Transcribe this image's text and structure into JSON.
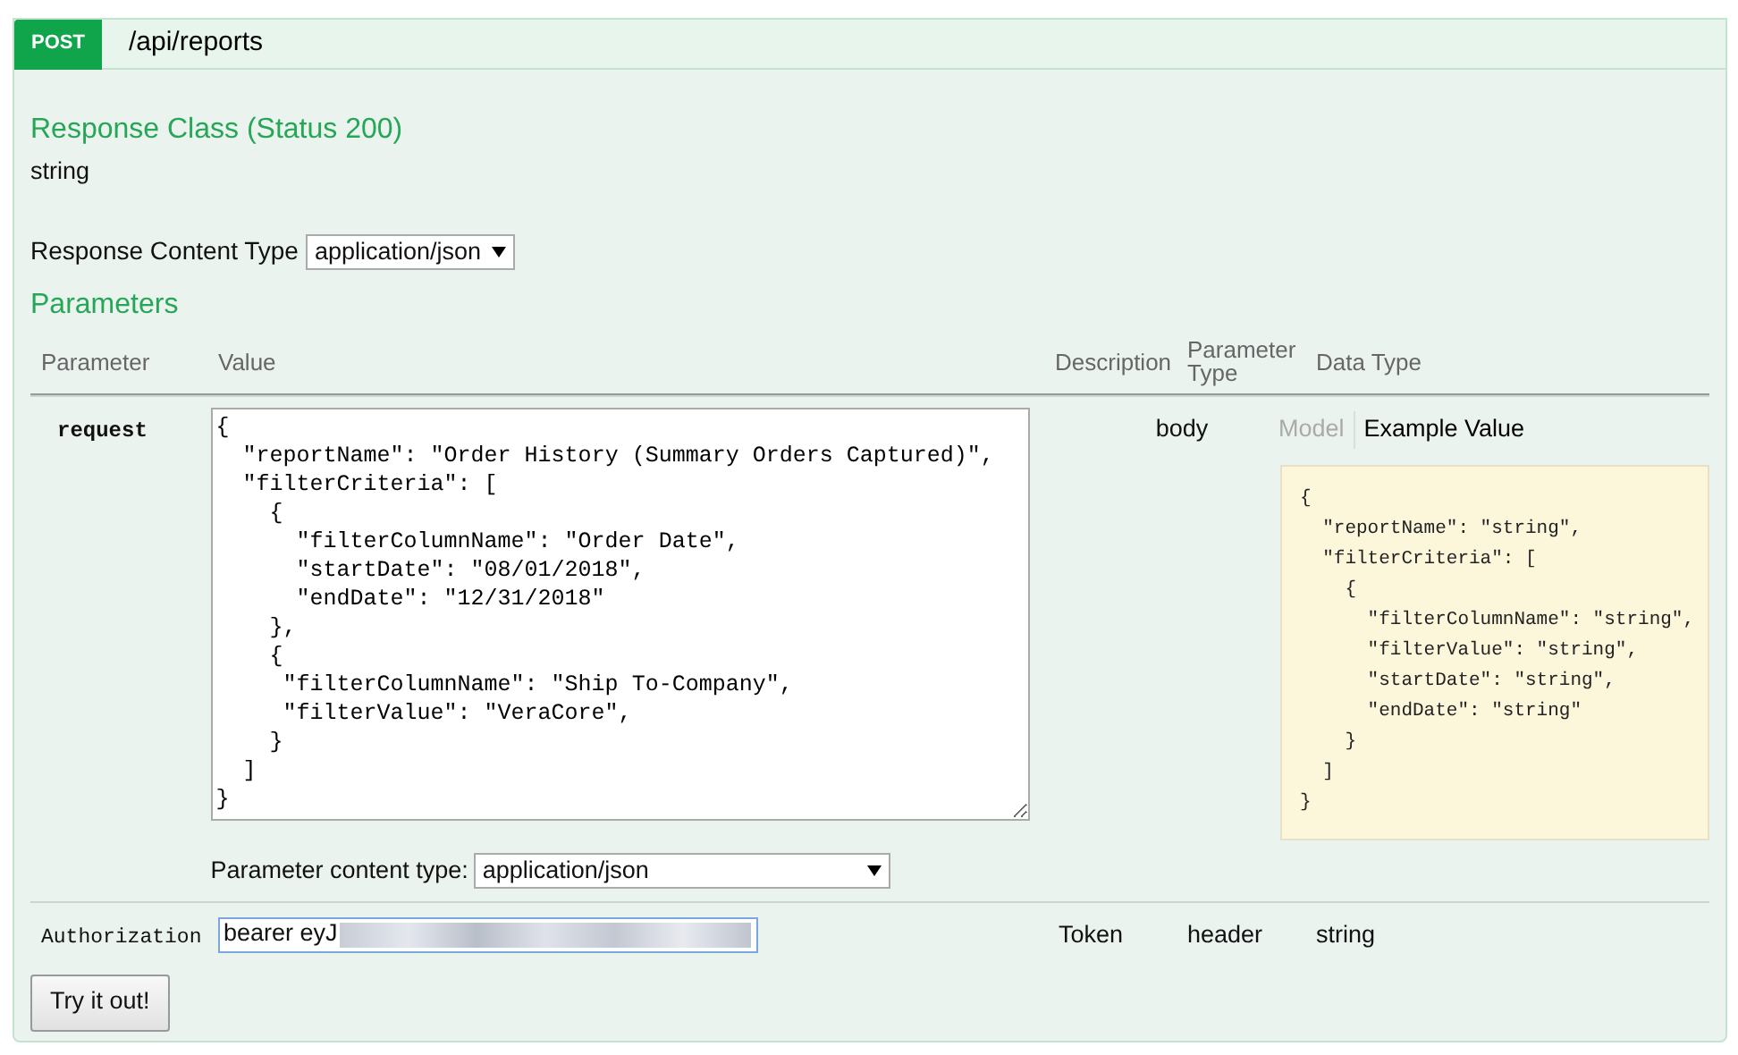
{
  "operation": {
    "method": "POST",
    "path": "/api/reports"
  },
  "response_class": {
    "heading": "Response Class (Status 200)",
    "type": "string"
  },
  "response_content_type": {
    "label": "Response Content Type",
    "value": "application/json"
  },
  "parameters": {
    "heading": "Parameters",
    "columns": [
      "Parameter",
      "Value",
      "Description",
      "Parameter Type",
      "Data Type"
    ],
    "rows": [
      {
        "kind": "body",
        "name": "request",
        "value_lines": [
          "{",
          "  \"reportName\": \"Order History (Summary Orders Captured)\",",
          "  \"filterCriteria\": [",
          "    {",
          "      \"filterColumnName\": \"Order Date\",",
          "      \"startDate\": \"08/01/2018\",",
          "      \"endDate\": \"12/31/2018\"",
          "    },",
          "    {",
          "     \"filterColumnName\": \"Ship To-Company\",",
          "     \"filterValue\": \"VeraCore\",",
          "    }",
          "  ]",
          "}"
        ],
        "description": "",
        "parameter_type": "body",
        "data_type_tabs": [
          {
            "label": "Model",
            "selected": false
          },
          {
            "label": "Example Value",
            "selected": true
          }
        ],
        "example_lines": [
          "{",
          "  \"reportName\": \"string\",",
          "  \"filterCriteria\": [",
          "    {",
          "      \"filterColumnName\": \"string\",",
          "      \"filterValue\": \"string\",",
          "      \"startDate\": \"string\",",
          "      \"endDate\": \"string\"",
          "    }",
          "  ]",
          "}"
        ],
        "content_type_label": "Parameter content type:",
        "content_type_value": "application/json"
      },
      {
        "kind": "text",
        "name": "Authorization",
        "value": "bearer eyJ",
        "description": "Token",
        "parameter_type": "header",
        "data_type": "string"
      }
    ]
  },
  "try_button": "Try it out!"
}
